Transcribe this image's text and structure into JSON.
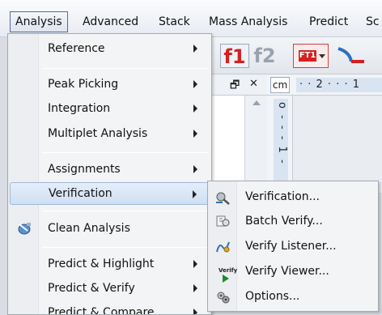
{
  "menubar": {
    "items": [
      {
        "label": "Analysis",
        "active": true
      },
      {
        "label": "Advanced"
      },
      {
        "label": "Stack"
      },
      {
        "label": "Mass Analysis"
      },
      {
        "label": "Predict"
      },
      {
        "label": "Sc"
      }
    ]
  },
  "toolbar": {
    "f1": "f1",
    "f2": "f2",
    "ft": "FT1"
  },
  "pane": {
    "pin": "ₐ",
    "close": "✕"
  },
  "ruler": {
    "unit": "cm",
    "horizontal": "· · 2 · · · 1",
    "vertical": "o - - - 1 -"
  },
  "menu": {
    "items": [
      {
        "label": "Reference",
        "submenu": true
      },
      {
        "label": "Peak Picking",
        "submenu": true
      },
      {
        "label": "Integration",
        "submenu": true
      },
      {
        "label": "Multiplet Analysis",
        "submenu": true
      },
      {
        "label": "Assignments",
        "submenu": true
      },
      {
        "label": "Verification",
        "submenu": true,
        "highlighted": true
      },
      {
        "label": "Clean Analysis",
        "icon": "clean-analysis-icon"
      },
      {
        "label": "Predict & Highlight",
        "submenu": true
      },
      {
        "label": "Predict & Verify",
        "submenu": true
      },
      {
        "label": "Predict & Compare",
        "submenu": true
      }
    ]
  },
  "submenu": {
    "items": [
      {
        "label": "Verification...",
        "icon": "verification-icon"
      },
      {
        "label": "Batch Verify...",
        "icon": "batch-verify-icon"
      },
      {
        "label": "Verify Listener...",
        "icon": "verify-listener-icon"
      },
      {
        "label": "Verify Viewer...",
        "icon": "verify-viewer-icon",
        "icon_text": "Verify"
      },
      {
        "label": "Options...",
        "icon": "options-icon"
      }
    ]
  },
  "colors": {
    "accent_red": "#d62020",
    "highlight": "#cfdff3",
    "play_green": "#1d8a2b"
  }
}
